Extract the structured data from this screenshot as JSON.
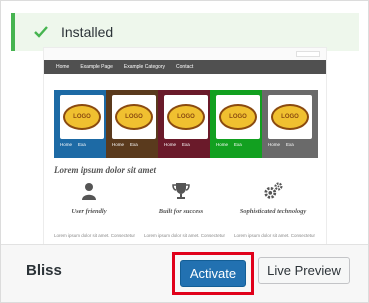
{
  "notice": {
    "text": "Installed",
    "color": "#46b450"
  },
  "preview": {
    "nav_items": [
      "Home",
      "Example Page",
      "Example Category",
      "Contact"
    ],
    "sheets": [
      {
        "color": "#1d6aa5",
        "nav": [
          "Home",
          "Exa"
        ]
      },
      {
        "color": "#5a3a1d",
        "nav": [
          "Home",
          "Exa"
        ]
      },
      {
        "color": "#6a1a2a",
        "nav": [
          "Home",
          "Exa"
        ]
      },
      {
        "color": "#12a020",
        "nav": [
          "Home",
          "Exa"
        ]
      },
      {
        "color": "#6a6a6a",
        "nav": [
          "Home",
          "Exa"
        ]
      }
    ],
    "logo_text": "LOGO",
    "heading": "Lorem ipsum dolor sit amet",
    "features": [
      {
        "icon": "user-icon",
        "label": "User friendly"
      },
      {
        "icon": "trophy-icon",
        "label": "Built for success"
      },
      {
        "icon": "gears-icon",
        "label": "Sophisticated technology"
      }
    ],
    "lorem": "Lorem ipsum dolor sit amet. Consectetur"
  },
  "theme": {
    "name": "Bliss"
  },
  "actions": {
    "activate_label": "Activate",
    "live_preview_label": "Live Preview",
    "primary_color": "#2271b1",
    "highlight_color": "#e0001a"
  }
}
